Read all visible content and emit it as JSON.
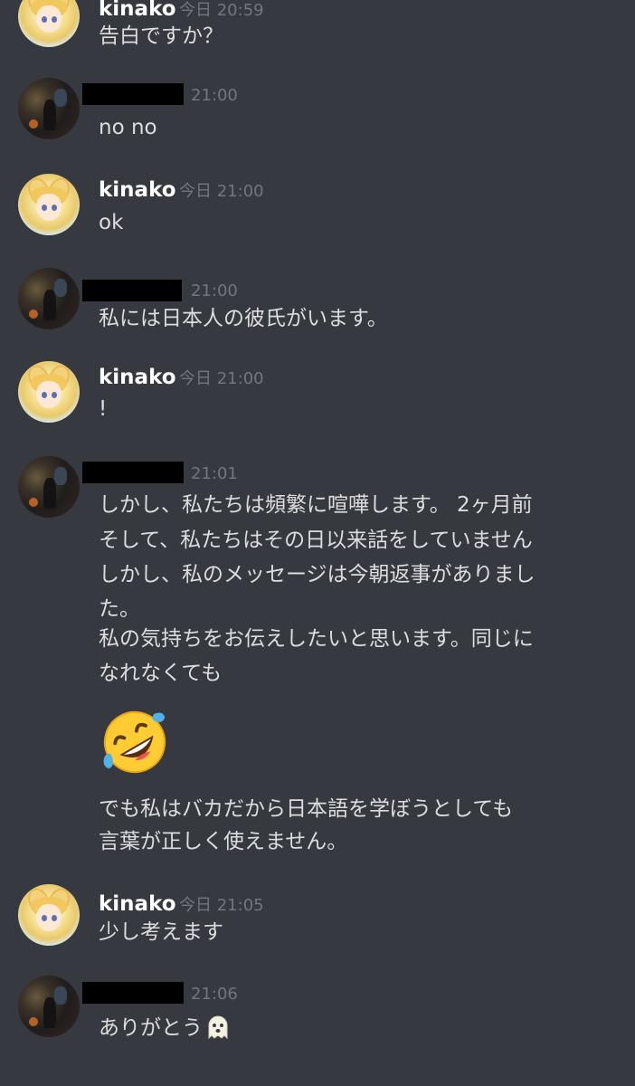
{
  "messages": [
    {
      "author": "kinako",
      "time": "今日 20:59",
      "lines": [
        "告白ですか？"
      ]
    },
    {
      "author": "",
      "time": "21:00",
      "lines": [
        "no no"
      ]
    },
    {
      "author": "kinako",
      "time": "今日 21:00",
      "lines": [
        "ok"
      ]
    },
    {
      "author": "",
      "time": "21:00",
      "lines": [
        "私には日本人の彼氏がいます。"
      ]
    },
    {
      "author": "kinako",
      "time": "今日 21:00",
      "lines": [
        "!"
      ]
    },
    {
      "author": "",
      "time": "21:01",
      "lines": [
        "しかし、私たちは頻繁に喧嘩します。 2ヶ月前",
        "そして、私たちはその日以来話をしていません",
        "しかし、私のメッセージは今朝返事がありまし",
        "た。",
        "私の気持ちをお伝えしたいと思います。同じに",
        "なれなくても"
      ],
      "emoji": "rolling-on-floor-laughing-emoji",
      "lines2": [
        "でも私はバカだから日本語を学ぼうとしても",
        "言葉が正しく使えません。"
      ]
    },
    {
      "author": "kinako",
      "time": "今日 21:05",
      "lines": [
        "少し考えます"
      ]
    },
    {
      "author": "",
      "time": "21:06",
      "lines": [
        "ありがとう"
      ],
      "emoji": "ghost-emoji"
    }
  ],
  "colors": {
    "background": "#36393f",
    "username": "#ffffff",
    "timestamp": "#72767d",
    "text": "#dcddde"
  }
}
